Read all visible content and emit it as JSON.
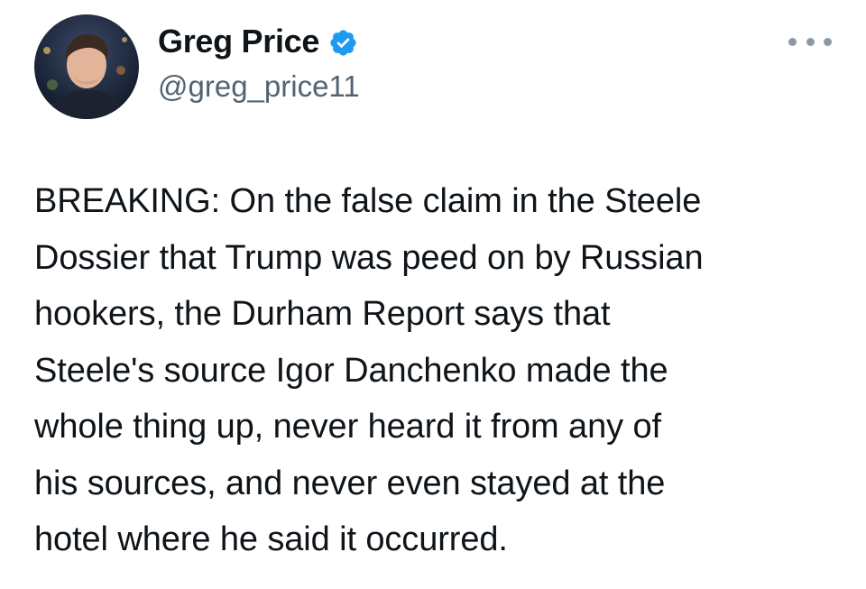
{
  "author": {
    "display_name": "Greg Price",
    "handle": "@greg_price11",
    "verified": true,
    "verified_color": "#1d9bf0",
    "avatar_icon": "profile-photo"
  },
  "actions": {
    "more_icon": "ellipsis-icon"
  },
  "tweet": {
    "lines": [
      "BREAKING: On the false claim in the Steele",
      "Dossier that Trump was peed on by Russian",
      "hookers, the Durham Report says that",
      "Steele's source Igor Danchenko made the",
      "whole thing up, never heard it from any of",
      "his sources, and never even stayed at the",
      "hotel where he said it occurred."
    ]
  }
}
